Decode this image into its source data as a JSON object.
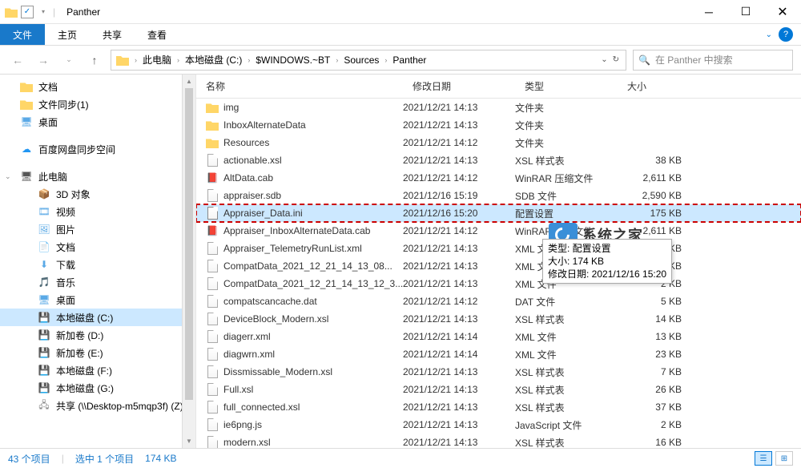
{
  "window": {
    "title": "Panther"
  },
  "ribbon": {
    "file": "文件",
    "home": "主页",
    "share": "共享",
    "view": "查看"
  },
  "breadcrumb": {
    "this_pc": "此电脑",
    "drive": "本地磁盘 (C:)",
    "folder1": "$WINDOWS.~BT",
    "folder2": "Sources",
    "folder3": "Panther"
  },
  "search": {
    "placeholder": "在 Panther 中搜索"
  },
  "sidebar": {
    "quick": [
      {
        "label": "文档",
        "icon": "folder"
      },
      {
        "label": "文件同步(1)",
        "icon": "folder"
      },
      {
        "label": "桌面",
        "icon": "desktop"
      }
    ],
    "baidu": {
      "label": "百度网盘同步空间",
      "icon": "cloud"
    },
    "thispc": {
      "label": "此电脑",
      "icon": "pc"
    },
    "pc_items": [
      {
        "label": "3D 对象",
        "icon": "3d"
      },
      {
        "label": "视频",
        "icon": "video"
      },
      {
        "label": "图片",
        "icon": "pictures"
      },
      {
        "label": "文档",
        "icon": "documents"
      },
      {
        "label": "下载",
        "icon": "downloads"
      },
      {
        "label": "音乐",
        "icon": "music"
      },
      {
        "label": "桌面",
        "icon": "desktop"
      },
      {
        "label": "本地磁盘 (C:)",
        "icon": "drive",
        "selected": true
      },
      {
        "label": "新加卷 (D:)",
        "icon": "drive"
      },
      {
        "label": "新加卷 (E:)",
        "icon": "drive"
      },
      {
        "label": "本地磁盘 (F:)",
        "icon": "drive"
      },
      {
        "label": "本地磁盘 (G:)",
        "icon": "drive"
      },
      {
        "label": "共享 (\\\\Desktop-m5mqp3f) (Z)",
        "icon": "netdrive"
      }
    ]
  },
  "columns": {
    "name": "名称",
    "date": "修改日期",
    "type": "类型",
    "size": "大小"
  },
  "files": [
    {
      "name": "img",
      "date": "2021/12/21 14:13",
      "type": "文件夹",
      "size": "",
      "icon": "folder"
    },
    {
      "name": "InboxAlternateData",
      "date": "2021/12/21 14:13",
      "type": "文件夹",
      "size": "",
      "icon": "folder"
    },
    {
      "name": "Resources",
      "date": "2021/12/21 14:12",
      "type": "文件夹",
      "size": "",
      "icon": "folder"
    },
    {
      "name": "actionable.xsl",
      "date": "2021/12/21 14:13",
      "type": "XSL 样式表",
      "size": "38 KB",
      "icon": "xsl"
    },
    {
      "name": "AltData.cab",
      "date": "2021/12/21 14:12",
      "type": "WinRAR 压缩文件",
      "size": "2,611 KB",
      "icon": "cab"
    },
    {
      "name": "appraiser.sdb",
      "date": "2021/12/16 15:19",
      "type": "SDB 文件",
      "size": "2,590 KB",
      "icon": "file"
    },
    {
      "name": "Appraiser_Data.ini",
      "date": "2021/12/16 15:20",
      "type": "配置设置",
      "size": "175 KB",
      "icon": "ini",
      "highlighted": true
    },
    {
      "name": "Appraiser_InboxAlternateData.cab",
      "date": "2021/12/21 14:12",
      "type": "WinRAR 压缩文件",
      "size": "2,611 KB",
      "icon": "cab"
    },
    {
      "name": "Appraiser_TelemetryRunList.xml",
      "date": "2021/12/21 14:13",
      "type": "XML 文件",
      "size": "132 KB",
      "icon": "xml"
    },
    {
      "name": "CompatData_2021_12_21_14_13_08...",
      "date": "2021/12/21 14:13",
      "type": "XML 文件",
      "size": "1 KB",
      "icon": "xml"
    },
    {
      "name": "CompatData_2021_12_21_14_13_12_3...",
      "date": "2021/12/21 14:13",
      "type": "XML 文件",
      "size": "2 KB",
      "icon": "xml"
    },
    {
      "name": "compatscancache.dat",
      "date": "2021/12/21 14:12",
      "type": "DAT 文件",
      "size": "5 KB",
      "icon": "file"
    },
    {
      "name": "DeviceBlock_Modern.xsl",
      "date": "2021/12/21 14:13",
      "type": "XSL 样式表",
      "size": "14 KB",
      "icon": "xsl"
    },
    {
      "name": "diagerr.xml",
      "date": "2021/12/21 14:14",
      "type": "XML 文件",
      "size": "13 KB",
      "icon": "xml"
    },
    {
      "name": "diagwrn.xml",
      "date": "2021/12/21 14:14",
      "type": "XML 文件",
      "size": "23 KB",
      "icon": "xml"
    },
    {
      "name": "Dissmissable_Modern.xsl",
      "date": "2021/12/21 14:13",
      "type": "XSL 样式表",
      "size": "7 KB",
      "icon": "xsl"
    },
    {
      "name": "Full.xsl",
      "date": "2021/12/21 14:13",
      "type": "XSL 样式表",
      "size": "26 KB",
      "icon": "xsl"
    },
    {
      "name": "full_connected.xsl",
      "date": "2021/12/21 14:13",
      "type": "XSL 样式表",
      "size": "37 KB",
      "icon": "xsl"
    },
    {
      "name": "ie6png.js",
      "date": "2021/12/21 14:13",
      "type": "JavaScript 文件",
      "size": "2 KB",
      "icon": "js"
    },
    {
      "name": "modern.xsl",
      "date": "2021/12/21 14:13",
      "type": "XSL 样式表",
      "size": "16 KB",
      "icon": "xsl"
    }
  ],
  "tooltip": {
    "line1": "类型: 配置设置",
    "line2": "大小: 174 KB",
    "line3": "修改日期: 2021/12/16 15:20"
  },
  "watermark": "系统之家",
  "status": {
    "count": "43 个项目",
    "selection": "选中 1 个项目",
    "size": "174 KB"
  }
}
